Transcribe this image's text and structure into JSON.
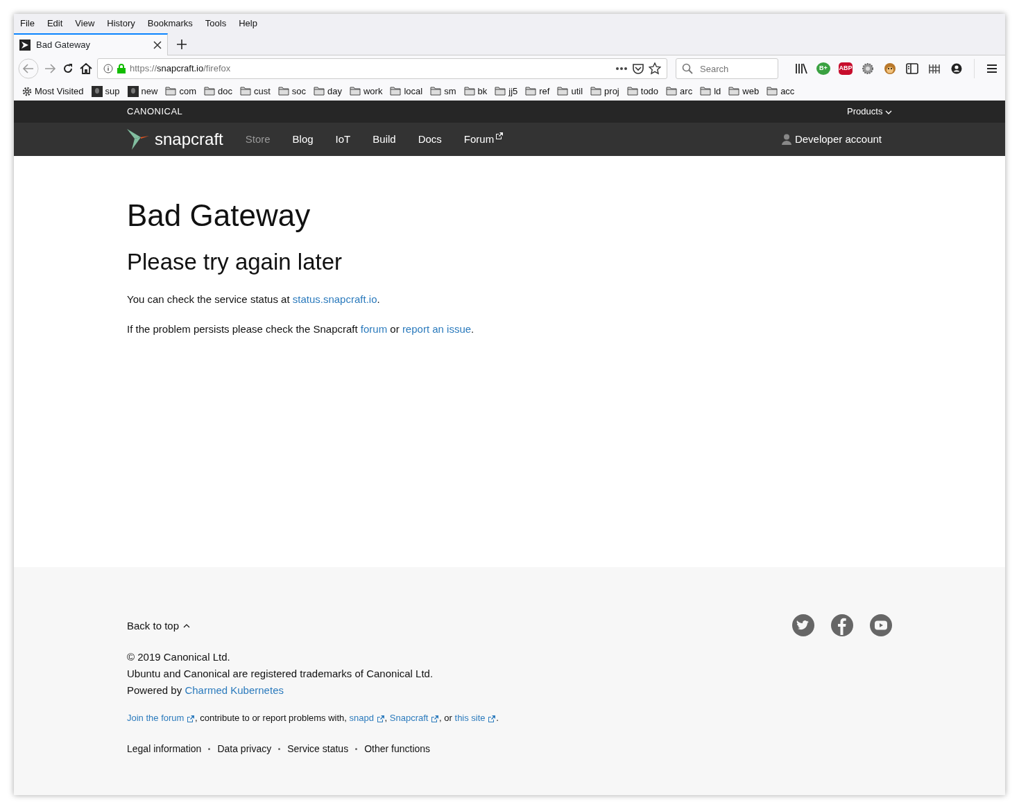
{
  "menu_bar": [
    "File",
    "Edit",
    "View",
    "History",
    "Bookmarks",
    "Tools",
    "Help"
  ],
  "tabs": [
    {
      "title": "Bad Gateway",
      "selected": true
    }
  ],
  "address_bar": {
    "scheme": "https://",
    "host": "snapcraft.io",
    "path": "/firefox"
  },
  "search": {
    "placeholder": "Search"
  },
  "extension_badges": [
    "B+",
    "ABP"
  ],
  "bookmarks": [
    {
      "label": "Most Visited",
      "kind": "gear"
    },
    {
      "label": "sup",
      "kind": "image"
    },
    {
      "label": "new",
      "kind": "image"
    },
    {
      "label": "com",
      "kind": "folder"
    },
    {
      "label": "doc",
      "kind": "folder"
    },
    {
      "label": "cust",
      "kind": "folder"
    },
    {
      "label": "soc",
      "kind": "folder"
    },
    {
      "label": "day",
      "kind": "folder"
    },
    {
      "label": "work",
      "kind": "folder"
    },
    {
      "label": "local",
      "kind": "folder"
    },
    {
      "label": "sm",
      "kind": "folder"
    },
    {
      "label": "bk",
      "kind": "folder"
    },
    {
      "label": "jj5",
      "kind": "folder"
    },
    {
      "label": "ref",
      "kind": "folder"
    },
    {
      "label": "util",
      "kind": "folder"
    },
    {
      "label": "proj",
      "kind": "folder"
    },
    {
      "label": "todo",
      "kind": "folder"
    },
    {
      "label": "arc",
      "kind": "folder"
    },
    {
      "label": "ld",
      "kind": "folder"
    },
    {
      "label": "web",
      "kind": "folder"
    },
    {
      "label": "acc",
      "kind": "folder"
    }
  ],
  "canonical_bar": {
    "logo": "CANONICAL",
    "menu": "Products"
  },
  "site_nav": {
    "logo": "snapcraft",
    "items": [
      {
        "label": "Store",
        "dimmed": true,
        "external": false
      },
      {
        "label": "Blog",
        "dimmed": false,
        "external": false
      },
      {
        "label": "IoT",
        "dimmed": false,
        "external": false
      },
      {
        "label": "Build",
        "dimmed": false,
        "external": false
      },
      {
        "label": "Docs",
        "dimmed": false,
        "external": false
      },
      {
        "label": "Forum",
        "dimmed": false,
        "external": true
      }
    ],
    "account": "Developer account"
  },
  "content": {
    "title": "Bad Gateway",
    "subtitle": "Please try again later",
    "paragraphs": [
      [
        {
          "text": "You can check the service status at "
        },
        {
          "link": "status.snapcraft.io",
          "external": false
        },
        {
          "text": "."
        }
      ],
      [
        {
          "text": "If the problem persists please check the Snapcraft "
        },
        {
          "link": "forum",
          "external": false
        },
        {
          "text": " or "
        },
        {
          "link": "report an issue",
          "external": false
        },
        {
          "text": "."
        }
      ]
    ]
  },
  "footer": {
    "back_to_top": "Back to top",
    "lines": [
      [
        {
          "text": "© 2019 Canonical Ltd."
        }
      ],
      [
        {
          "text": "Ubuntu and Canonical are registered trademarks of Canonical Ltd."
        }
      ],
      [
        {
          "text": "Powered by "
        },
        {
          "link": "Charmed Kubernetes",
          "external": false
        }
      ]
    ],
    "contribute": [
      {
        "link": "Join the forum",
        "external": true
      },
      {
        "text": ", contribute to or report problems with, "
      },
      {
        "link": "snapd",
        "external": true
      },
      {
        "text": ", "
      },
      {
        "link": "Snapcraft",
        "external": true
      },
      {
        "text": ", or "
      },
      {
        "link": "this site",
        "external": true
      },
      {
        "text": "."
      }
    ],
    "links": [
      "Legal information",
      "Data privacy",
      "Service status",
      "Other functions"
    ],
    "social": [
      {
        "kind": "bird"
      },
      {
        "kind": "f"
      },
      {
        "kind": "play"
      }
    ]
  }
}
